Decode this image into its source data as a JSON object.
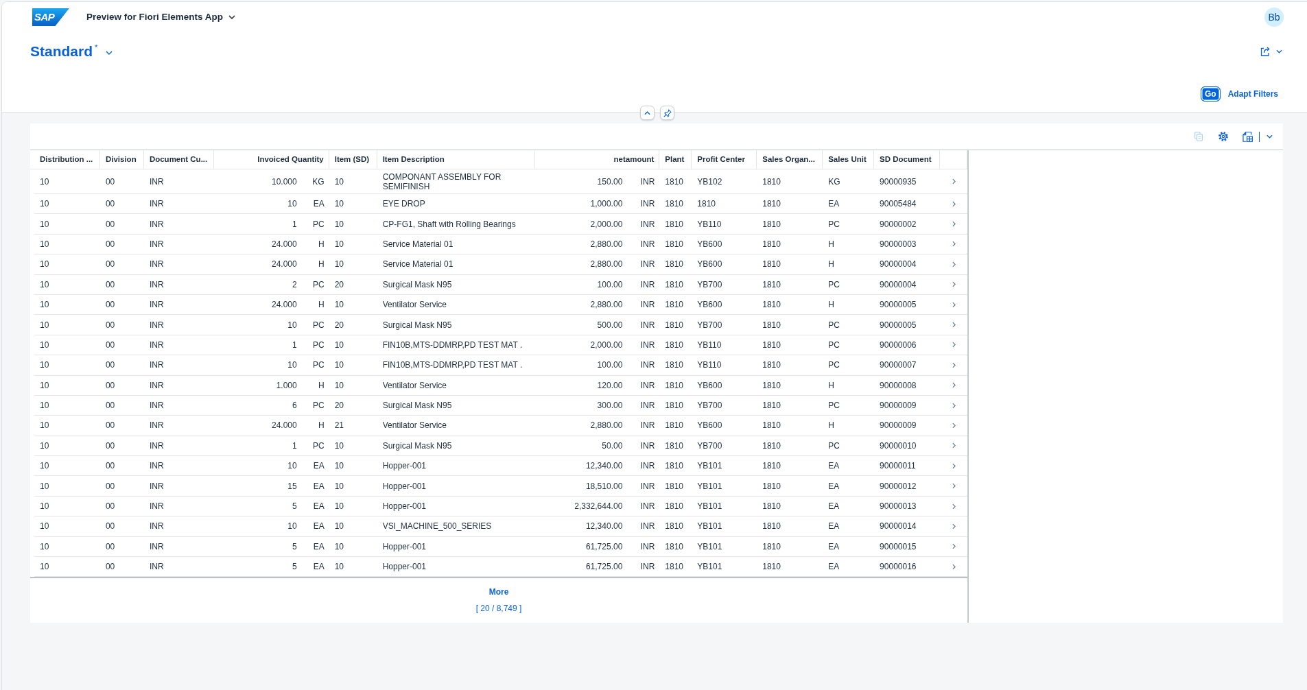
{
  "shell_bar": {
    "logo_text": "SAP",
    "title": "Preview for Fiori Elements App",
    "avatar_initials": "Bb"
  },
  "variant": {
    "title": "Standard",
    "modified_marker": "*"
  },
  "filter_bar": {
    "buttons": [
      {
        "label": "Go",
        "kind": "emphasized"
      },
      {
        "label": "Adapt Filters",
        "kind": "transparent"
      }
    ]
  },
  "table": {
    "toolbar": {
      "copy_button": {
        "disabled": true
      }
    },
    "columns": [
      {
        "label": "Distribution ...",
        "kind": "text"
      },
      {
        "label": "Division",
        "kind": "text"
      },
      {
        "label": "Document Cu...",
        "kind": "text"
      },
      {
        "label": "Invoiced Quantity",
        "kind": "quantity"
      },
      {
        "label": "Item (SD)",
        "kind": "text"
      },
      {
        "label": "Item Description",
        "kind": "text"
      },
      {
        "label": "netamount",
        "kind": "amount"
      },
      {
        "label": "Plant",
        "kind": "text"
      },
      {
        "label": "Profit Center",
        "kind": "text"
      },
      {
        "label": "Sales Organ...",
        "kind": "text"
      },
      {
        "label": "Sales Unit",
        "kind": "text"
      },
      {
        "label": "SD Document",
        "kind": "text"
      }
    ],
    "rows": [
      {
        "cells": [
          "10",
          "00",
          "INR",
          {
            "value": "10.000",
            "unit": "KG"
          },
          "10",
          "COMPONANT ASSEMBLY FOR SEMIFINISH",
          {
            "value": "150.00",
            "unit": "INR"
          },
          "1810",
          "YB102",
          "1810",
          "KG",
          "90000935"
        ]
      },
      {
        "cells": [
          "10",
          "00",
          "INR",
          {
            "value": "10",
            "unit": "EA"
          },
          "10",
          "EYE DROP",
          {
            "value": "1,000.00",
            "unit": "INR"
          },
          "1810",
          "1810",
          "1810",
          "EA",
          "90005484"
        ]
      },
      {
        "cells": [
          "10",
          "00",
          "INR",
          {
            "value": "1",
            "unit": "PC"
          },
          "10",
          "CP-FG1, Shaft with Rolling Bearings",
          {
            "value": "2,000.00",
            "unit": "INR"
          },
          "1810",
          "YB110",
          "1810",
          "PC",
          "90000002"
        ]
      },
      {
        "cells": [
          "10",
          "00",
          "INR",
          {
            "value": "24.000",
            "unit": "H"
          },
          "10",
          "Service Material 01",
          {
            "value": "2,880.00",
            "unit": "INR"
          },
          "1810",
          "YB600",
          "1810",
          "H",
          "90000003"
        ]
      },
      {
        "cells": [
          "10",
          "00",
          "INR",
          {
            "value": "24.000",
            "unit": "H"
          },
          "10",
          "Service Material 01",
          {
            "value": "2,880.00",
            "unit": "INR"
          },
          "1810",
          "YB600",
          "1810",
          "H",
          "90000004"
        ]
      },
      {
        "cells": [
          "10",
          "00",
          "INR",
          {
            "value": "2",
            "unit": "PC"
          },
          "20",
          "Surgical Mask N95",
          {
            "value": "100.00",
            "unit": "INR"
          },
          "1810",
          "YB700",
          "1810",
          "PC",
          "90000004"
        ]
      },
      {
        "cells": [
          "10",
          "00",
          "INR",
          {
            "value": "24.000",
            "unit": "H"
          },
          "10",
          "Ventilator Service",
          {
            "value": "2,880.00",
            "unit": "INR"
          },
          "1810",
          "YB600",
          "1810",
          "H",
          "90000005"
        ]
      },
      {
        "cells": [
          "10",
          "00",
          "INR",
          {
            "value": "10",
            "unit": "PC"
          },
          "20",
          "Surgical Mask N95",
          {
            "value": "500.00",
            "unit": "INR"
          },
          "1810",
          "YB700",
          "1810",
          "PC",
          "90000005"
        ]
      },
      {
        "cells": [
          "10",
          "00",
          "INR",
          {
            "value": "1",
            "unit": "PC"
          },
          "10",
          "FIN10B,MTS-DDMRP,PD TEST MAT .",
          {
            "value": "2,000.00",
            "unit": "INR"
          },
          "1810",
          "YB110",
          "1810",
          "PC",
          "90000006"
        ]
      },
      {
        "cells": [
          "10",
          "00",
          "INR",
          {
            "value": "10",
            "unit": "PC"
          },
          "10",
          "FIN10B,MTS-DDMRP,PD TEST MAT .",
          {
            "value": "100.00",
            "unit": "INR"
          },
          "1810",
          "YB110",
          "1810",
          "PC",
          "90000007"
        ]
      },
      {
        "cells": [
          "10",
          "00",
          "INR",
          {
            "value": "1.000",
            "unit": "H"
          },
          "10",
          "Ventilator Service",
          {
            "value": "120.00",
            "unit": "INR"
          },
          "1810",
          "YB600",
          "1810",
          "H",
          "90000008"
        ]
      },
      {
        "cells": [
          "10",
          "00",
          "INR",
          {
            "value": "6",
            "unit": "PC"
          },
          "20",
          "Surgical Mask N95",
          {
            "value": "300.00",
            "unit": "INR"
          },
          "1810",
          "YB700",
          "1810",
          "PC",
          "90000009"
        ]
      },
      {
        "cells": [
          "10",
          "00",
          "INR",
          {
            "value": "24.000",
            "unit": "H"
          },
          "21",
          "Ventilator Service",
          {
            "value": "2,880.00",
            "unit": "INR"
          },
          "1810",
          "YB600",
          "1810",
          "H",
          "90000009"
        ]
      },
      {
        "cells": [
          "10",
          "00",
          "INR",
          {
            "value": "1",
            "unit": "PC"
          },
          "10",
          "Surgical Mask N95",
          {
            "value": "50.00",
            "unit": "INR"
          },
          "1810",
          "YB700",
          "1810",
          "PC",
          "90000010"
        ]
      },
      {
        "cells": [
          "10",
          "00",
          "INR",
          {
            "value": "10",
            "unit": "EA"
          },
          "10",
          "Hopper-001",
          {
            "value": "12,340.00",
            "unit": "INR"
          },
          "1810",
          "YB101",
          "1810",
          "EA",
          "90000011"
        ]
      },
      {
        "cells": [
          "10",
          "00",
          "INR",
          {
            "value": "15",
            "unit": "EA"
          },
          "10",
          "Hopper-001",
          {
            "value": "18,510.00",
            "unit": "INR"
          },
          "1810",
          "YB101",
          "1810",
          "EA",
          "90000012"
        ]
      },
      {
        "cells": [
          "10",
          "00",
          "INR",
          {
            "value": "5",
            "unit": "EA"
          },
          "10",
          "Hopper-001",
          {
            "value": "2,332,644.00",
            "unit": "INR"
          },
          "1810",
          "YB101",
          "1810",
          "EA",
          "90000013"
        ]
      },
      {
        "cells": [
          "10",
          "00",
          "INR",
          {
            "value": "10",
            "unit": "EA"
          },
          "10",
          "VSI_MACHINE_500_SERIES",
          {
            "value": "12,340.00",
            "unit": "INR"
          },
          "1810",
          "YB101",
          "1810",
          "EA",
          "90000014"
        ]
      },
      {
        "cells": [
          "10",
          "00",
          "INR",
          {
            "value": "5",
            "unit": "EA"
          },
          "10",
          "Hopper-001",
          {
            "value": "61,725.00",
            "unit": "INR"
          },
          "1810",
          "YB101",
          "1810",
          "EA",
          "90000015"
        ]
      },
      {
        "cells": [
          "10",
          "00",
          "INR",
          {
            "value": "5",
            "unit": "EA"
          },
          "10",
          "Hopper-001",
          {
            "value": "61,725.00",
            "unit": "INR"
          },
          "1810",
          "YB101",
          "1810",
          "EA",
          "90000016"
        ]
      }
    ],
    "growing": {
      "label": "More",
      "count": "[ 20 / 8,749 ]"
    }
  }
}
